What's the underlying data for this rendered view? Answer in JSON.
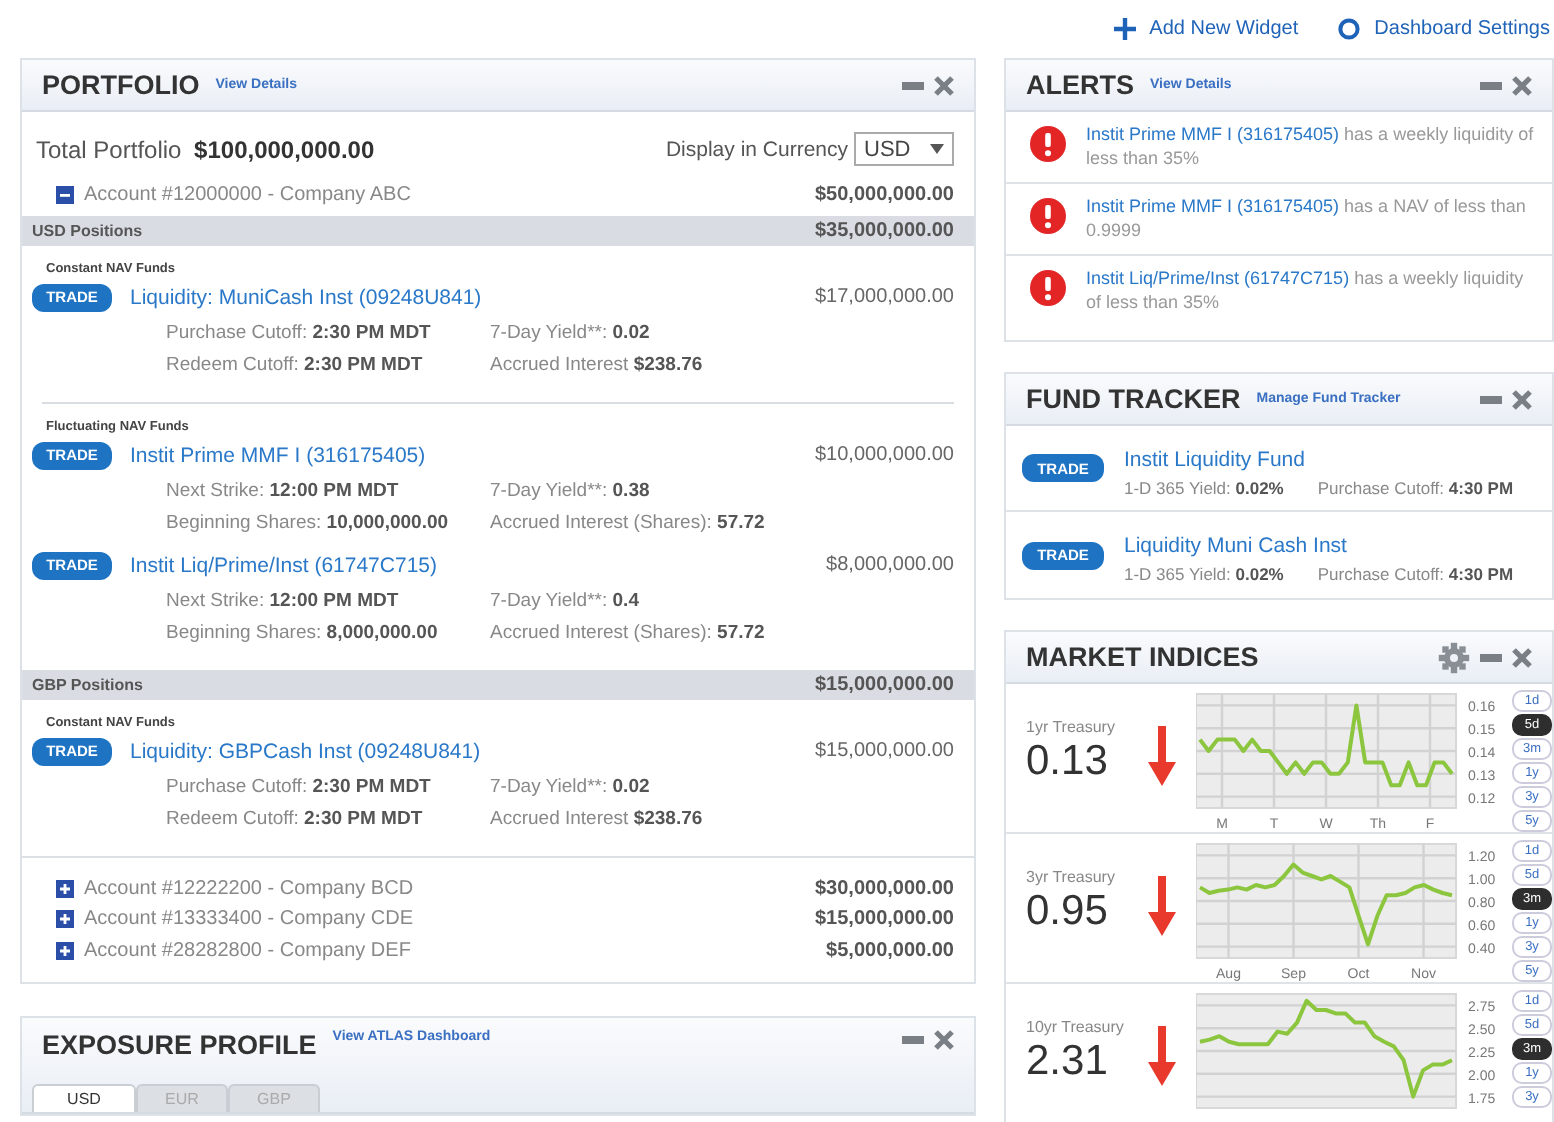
{
  "top_links": [
    {
      "kind": "add",
      "label": "Add New Widget"
    },
    {
      "kind": "settings",
      "label": "Dashboard Settings"
    }
  ],
  "portfolio": {
    "title": "PORTFOLIO",
    "link": "View Details",
    "total_label": "Total Portfolio",
    "total_value": "$100,000,000.00",
    "currency_label": "Display in Currency",
    "currency": "USD",
    "accounts": [
      {
        "name": "Account #12000000 - Company ABC",
        "amount": "$50,000,000.00",
        "expanded": true,
        "positions": [
          {
            "label": "USD Positions",
            "amount": "$35,000,000.00",
            "groups": [
              {
                "label": "Constant NAV Funds",
                "funds": [
                  {
                    "button": "TRADE",
                    "name": "Liquidity: MuniCash Inst (09248U841)",
                    "amount": "$17,000,000.00",
                    "details": [
                      {
                        "label": "Purchase Cutoff:",
                        "value": "2:30 PM MDT"
                      },
                      {
                        "label": "7-Day Yield**:",
                        "value": "0.02"
                      },
                      {
                        "label": "Redeem Cutoff:",
                        "value": "2:30 PM MDT"
                      },
                      {
                        "label": "Accrued Interest",
                        "value": "$238.76"
                      }
                    ]
                  }
                ]
              },
              {
                "label": "Fluctuating NAV Funds",
                "funds": [
                  {
                    "button": "TRADE",
                    "name": "Instit Prime MMF I (316175405)",
                    "amount": "$10,000,000.00",
                    "details": [
                      {
                        "label": "Next Strike:",
                        "value": "12:00 PM MDT"
                      },
                      {
                        "label": "7-Day Yield**:",
                        "value": "0.38"
                      },
                      {
                        "label": "Beginning Shares:",
                        "value": "10,000,000.00"
                      },
                      {
                        "label": "Accrued Interest (Shares):",
                        "value": "57.72"
                      }
                    ]
                  },
                  {
                    "button": "TRADE",
                    "name": "Instit Liq/Prime/Inst (61747C715)",
                    "amount": "$8,000,000.00",
                    "details": [
                      {
                        "label": "Next Strike:",
                        "value": "12:00 PM MDT"
                      },
                      {
                        "label": "7-Day Yield**:",
                        "value": "0.4"
                      },
                      {
                        "label": "Beginning Shares:",
                        "value": "8,000,000.00"
                      },
                      {
                        "label": "Accrued Interest (Shares):",
                        "value": "57.72"
                      }
                    ]
                  }
                ]
              }
            ]
          },
          {
            "label": "GBP Positions",
            "amount": "$15,000,000.00",
            "groups": [
              {
                "label": "Constant NAV Funds",
                "funds": [
                  {
                    "button": "TRADE",
                    "name": "Liquidity: GBPCash Inst (09248U841)",
                    "amount": "$15,000,000.00",
                    "details": [
                      {
                        "label": "Purchase Cutoff:",
                        "value": "2:30 PM MDT"
                      },
                      {
                        "label": "7-Day Yield**:",
                        "value": "0.02"
                      },
                      {
                        "label": "Redeem Cutoff:",
                        "value": "2:30 PM MDT"
                      },
                      {
                        "label": "Accrued Interest",
                        "value": "$238.76"
                      }
                    ]
                  }
                ]
              }
            ]
          }
        ]
      },
      {
        "name": "Account #12222200 - Company BCD",
        "amount": "$30,000,000.00",
        "expanded": false
      },
      {
        "name": "Account #13333400 - Company CDE",
        "amount": "$15,000,000.00",
        "expanded": false
      },
      {
        "name": "Account #28282800 - Company DEF",
        "amount": "$5,000,000.00",
        "expanded": false
      }
    ]
  },
  "exposure_profile": {
    "title": "EXPOSURE PROFILE",
    "link": "View ATLAS Dashboard",
    "tabs": [
      {
        "label": "USD",
        "selected": true
      },
      {
        "label": "EUR",
        "selected": false
      },
      {
        "label": "GBP",
        "selected": false
      }
    ]
  },
  "alerts": {
    "title": "ALERTS",
    "link": "View Details",
    "items": [
      {
        "fund": "Instit Prime MMF I (316175405)",
        "text": "has a weekly liquidity of less than 35%"
      },
      {
        "fund": "Instit Prime MMF I (316175405)",
        "text": "has a NAV of less than 0.9999"
      },
      {
        "fund": "Instit Liq/Prime/Inst (61747C715)",
        "text": "has a weekly liquidity of less than 35%"
      }
    ]
  },
  "fund_tracker": {
    "title": "FUND TRACKER",
    "link": "Manage Fund Tracker",
    "items": [
      {
        "button": "TRADE",
        "name": "Instit Liquidity Fund",
        "yield_label": "1-D 365 Yield:",
        "yield": "0.02%",
        "cutoff_label": "Purchase Cutoff:",
        "cutoff": "4:30 PM"
      },
      {
        "button": "TRADE",
        "name": "Liquidity Muni Cash Inst",
        "yield_label": "1-D 365 Yield:",
        "yield": "0.02%",
        "cutoff_label": "Purchase Cutoff:",
        "cutoff": "4:30 PM"
      }
    ]
  },
  "market_indices": {
    "title": "MARKET INDICES",
    "settings_button": true,
    "rows": [
      {
        "label": "1yr Treasury",
        "value": "0.13",
        "falling": true,
        "periods": [
          {
            "label": "1d",
            "selected": false
          },
          {
            "label": "5d",
            "selected": true
          },
          {
            "label": "3m",
            "selected": false
          },
          {
            "label": "1y",
            "selected": false
          },
          {
            "label": "3y",
            "selected": false
          },
          {
            "label": "5y",
            "selected": false
          }
        ],
        "y_labels": [
          "0.16",
          "0.15",
          "0.14",
          "0.13",
          "0.12"
        ],
        "x_labels": [
          "M",
          "T",
          "W",
          "Th",
          "F"
        ]
      },
      {
        "label": "3yr Treasury",
        "value": "0.95",
        "falling": true,
        "periods": [
          {
            "label": "1d",
            "selected": false
          },
          {
            "label": "5d",
            "selected": false
          },
          {
            "label": "3m",
            "selected": true
          },
          {
            "label": "1y",
            "selected": false
          },
          {
            "label": "3y",
            "selected": false
          },
          {
            "label": "5y",
            "selected": false
          }
        ],
        "y_labels": [
          "1.20",
          "1.00",
          "0.80",
          "0.60",
          "0.40"
        ],
        "x_labels": [
          "Aug",
          "Sep",
          "Oct",
          "Nov"
        ]
      },
      {
        "label": "10yr Treasury",
        "value": "2.31",
        "falling": true,
        "periods": [
          {
            "label": "1d",
            "selected": false
          },
          {
            "label": "5d",
            "selected": false
          },
          {
            "label": "3m",
            "selected": true
          },
          {
            "label": "1y",
            "selected": false
          },
          {
            "label": "3y",
            "selected": false
          }
        ],
        "y_labels": [
          "2.75",
          "2.50",
          "2.25",
          "2.00",
          "1.75"
        ]
      }
    ]
  }
}
